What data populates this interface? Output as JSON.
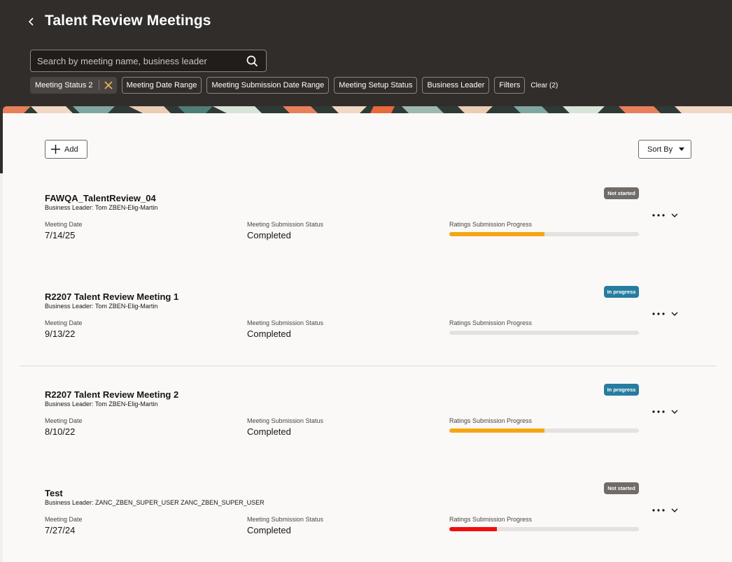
{
  "header": {
    "title": "Talent Review Meetings",
    "search_placeholder": "Search by meeting name, business leader"
  },
  "filters": {
    "chips": [
      {
        "label": "Meeting Status 2",
        "active": true
      },
      {
        "label": "Meeting Date Range"
      },
      {
        "label": "Meeting Submission Date Range"
      },
      {
        "label": "Meeting Setup Status"
      },
      {
        "label": "Business Leader"
      },
      {
        "label": "Filters"
      }
    ],
    "clear_label": "Clear (2)"
  },
  "toolbar": {
    "add_label": "Add",
    "sort_label": "Sort By"
  },
  "columns": {
    "date_label": "Meeting Date",
    "submission_label": "Meeting Submission Status",
    "progress_label": "Ratings Submission Progress"
  },
  "meetings": [
    {
      "name": "FAWQA_TalentReview_04",
      "leader": "Business Leader: Tom ZBEN-Elig-Martin",
      "status": "Not started",
      "status_color": "#716c68",
      "date": "7/14/25",
      "submission": "Completed",
      "progress": 0.5,
      "progress_color": "#f5a612"
    },
    {
      "name": "R2207 Talent Review Meeting 1",
      "leader": "Business Leader: Tom ZBEN-Elig-Martin",
      "status": "In progress",
      "status_color": "#277d9f",
      "date": "9/13/22",
      "submission": "Completed",
      "progress": 0,
      "progress_color": "#f5a612"
    },
    {
      "name": "R2207 Talent Review Meeting 2",
      "leader": "Business Leader: Tom ZBEN-Elig-Martin",
      "status": "In progress",
      "status_color": "#277d9f",
      "date": "8/10/22",
      "submission": "Completed",
      "progress": 0.5,
      "progress_color": "#f5a612"
    },
    {
      "name": "Test",
      "leader": "Business Leader: ZANC_ZBEN_SUPER_USER ZANC_ZBEN_SUPER_USER",
      "status": "Not started",
      "status_color": "#716c68",
      "date": "7/27/24",
      "submission": "Completed",
      "progress": 0.25,
      "progress_color": "#f20d0d"
    }
  ]
}
